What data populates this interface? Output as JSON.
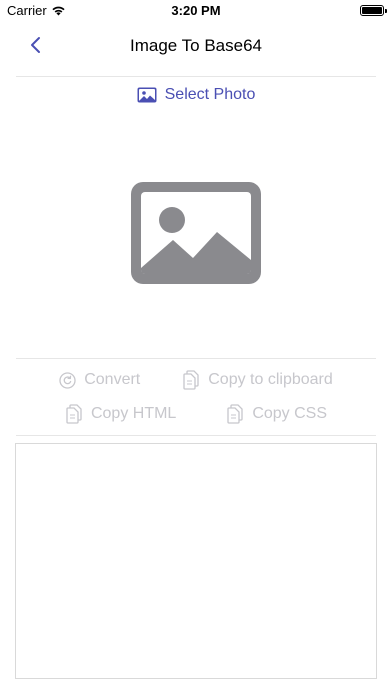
{
  "status_bar": {
    "carrier": "Carrier",
    "time": "3:20 PM"
  },
  "nav": {
    "title": "Image To Base64",
    "back_icon": "chevron-left-icon"
  },
  "select_photo": {
    "label": "Select Photo",
    "icon": "photo-icon"
  },
  "placeholder": {
    "icon": "image-placeholder-icon"
  },
  "actions": {
    "convert": "Convert",
    "copy_clipboard": "Copy to clipboard",
    "copy_html": "Copy HTML",
    "copy_css": "Copy CSS"
  },
  "output": {
    "value": ""
  },
  "colors": {
    "accent": "#4a4fb3",
    "disabled": "#c7c7cc",
    "placeholder_gray": "#8a8a8e"
  }
}
